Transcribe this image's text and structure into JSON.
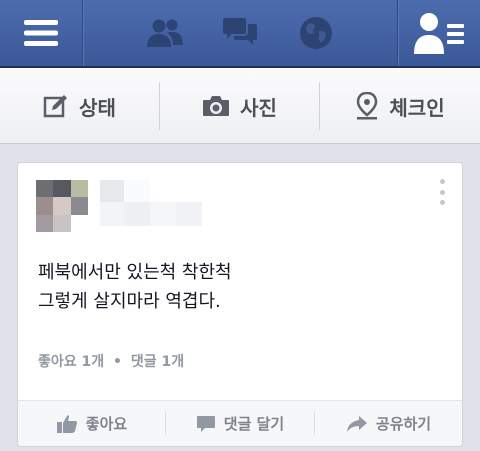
{
  "topbar": {
    "icons": [
      "menu-icon",
      "friends-icon",
      "messages-icon",
      "globe-icon",
      "friend-requests-icon"
    ],
    "colors": {
      "bar": "#3b5998",
      "icon_active": "#ffffff",
      "icon_dim": "#2c4373"
    }
  },
  "actionbar": {
    "status": {
      "label": "상태",
      "icon": "edit-icon"
    },
    "photo": {
      "label": "사진",
      "icon": "camera-icon"
    },
    "checkin": {
      "label": "체크인",
      "icon": "location-pin-icon"
    }
  },
  "post": {
    "line1": "페북에서만 있는척 착한척",
    "line2": "그렇게 살지마라 역겹다.",
    "counts": {
      "likes": "좋아요 1개",
      "separator": "•",
      "comments": "댓글 1개"
    },
    "actions": {
      "like": "좋아요",
      "comment": "댓글 달기",
      "share": "공유하기"
    }
  }
}
